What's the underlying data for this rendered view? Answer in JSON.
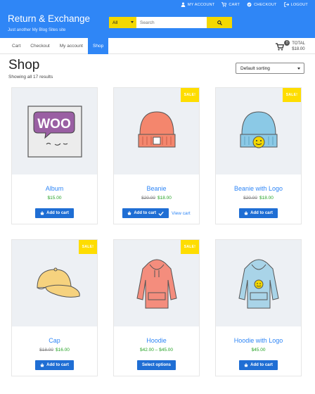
{
  "header": {
    "site_title": "Return & Exchange",
    "site_description": "Just another My Blog Sites site",
    "top_links": [
      {
        "label": "MY ACCOUNT",
        "icon": "user-icon"
      },
      {
        "label": "CART",
        "icon": "cart-icon"
      },
      {
        "label": "CHECKOUT",
        "icon": "checkout-icon"
      },
      {
        "label": "LOGOUT",
        "icon": "logout-icon"
      }
    ],
    "search": {
      "category": "All",
      "placeholder": "Search"
    }
  },
  "nav": {
    "items": [
      {
        "label": "Cart"
      },
      {
        "label": "Checkout"
      },
      {
        "label": "My account"
      },
      {
        "label": "Shop",
        "active": true
      }
    ],
    "cart": {
      "count": "0",
      "total_label": "TOTAL",
      "total": "$18.00"
    }
  },
  "page": {
    "title": "Shop",
    "result_count": "Showing all 17 results",
    "sort": "Default sorting"
  },
  "products": [
    {
      "name": "Album",
      "price": "$15.00",
      "button": "Add to cart",
      "sale": false
    },
    {
      "name": "Beanie",
      "old_price": "$20.00",
      "price": "$18.00",
      "button": "Add to cart",
      "sale": true,
      "sale_label": "SALE!",
      "view_cart": "View cart"
    },
    {
      "name": "Beanie with Logo",
      "old_price": "$20.00",
      "price": "$18.00",
      "button": "Add to cart",
      "sale": true,
      "sale_label": "SALE!"
    },
    {
      "name": "Cap",
      "old_price": "$18.00",
      "price": "$16.00",
      "button": "Add to cart",
      "sale": true,
      "sale_label": "SALE!"
    },
    {
      "name": "Hoodie",
      "price": "$42.00 – $45.00",
      "button": "Select options",
      "sale": true,
      "sale_label": "SALE!"
    },
    {
      "name": "Hoodie with Logo",
      "price": "$45.00",
      "button": "Add to cart",
      "sale": false
    }
  ],
  "colors": {
    "primary": "#2f86f6",
    "accent": "#fedd00",
    "button": "#1f6ed4",
    "price": "#24a224"
  }
}
